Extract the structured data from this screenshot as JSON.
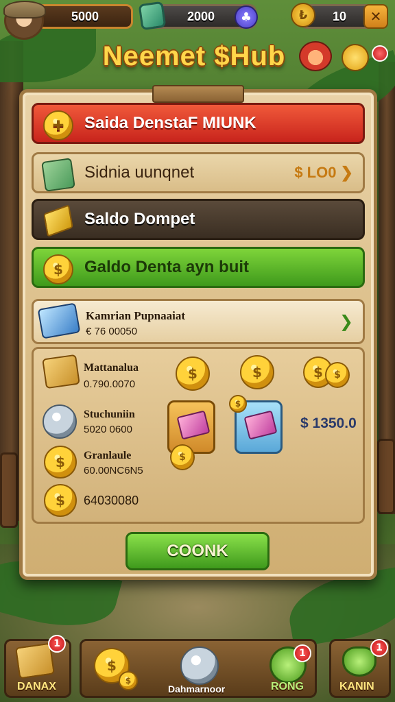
{
  "topbar": {
    "cash": "5000",
    "gems": "2000",
    "plus_icon": "♣",
    "level": "10",
    "close_icon": "✕",
    "bolt_icon": "₺"
  },
  "title": "Neemet $Hub",
  "menu": {
    "row1": {
      "label": "Saida DenstaF MIUNK",
      "icon": "✚"
    },
    "row2": {
      "label": "Sidnia uunqnet",
      "price": "$ LO0 ❯"
    },
    "row3": {
      "label": "Saldo Dompet"
    },
    "row4": {
      "label": "Galdo Denta ayn buit",
      "icon": "$"
    }
  },
  "subheader": {
    "title": "Kamrian Pupnaaiat",
    "value": "€ 76 00050",
    "chevron": "❯"
  },
  "list": [
    {
      "label": "Mattanalua",
      "value": "0.790.0070"
    },
    {
      "label": "Stuchuniin",
      "value": "5020 0600"
    },
    {
      "label": "Granlaule",
      "value": "60.00NC6N5"
    },
    {
      "label": "",
      "value": "64030080"
    }
  ],
  "coin_glyph": "$",
  "shop_price": "$ 1350.0",
  "cook_button": "COONK",
  "bottom_nav": {
    "left_label": "DANAX",
    "left_badge": "1",
    "mid_label": "Dahmarnoor",
    "mid_right_label": "RONG",
    "mid_badge": "1",
    "right_label": "KANIN",
    "right_badge": "1"
  }
}
